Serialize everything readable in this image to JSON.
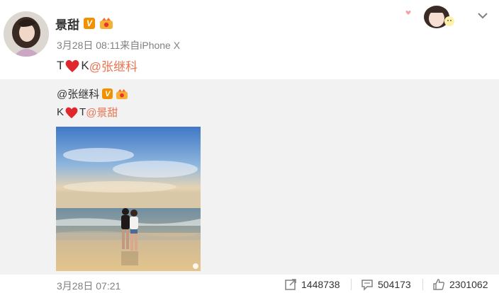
{
  "post": {
    "author": "景甜",
    "verified_badge": "V",
    "meta": "3月28日 08:11来自iPhone X",
    "text_prefix": "T",
    "text_mid": "K",
    "mention": "@张继科"
  },
  "repost": {
    "author": "@张继科",
    "verified_badge": "V",
    "text_prefix": "K",
    "text_mid": "T",
    "mention": "@景甜",
    "image_watermark_icon": "weibo-icon"
  },
  "footer": {
    "date": "3月28日 07:21",
    "share_count": "1448738",
    "comment_count": "504173",
    "like_count": "2301062"
  },
  "colors": {
    "mention": "#eb7350",
    "badge": "#f29100",
    "heart": "#e0282c",
    "repost_bg": "#f2f2f2"
  }
}
